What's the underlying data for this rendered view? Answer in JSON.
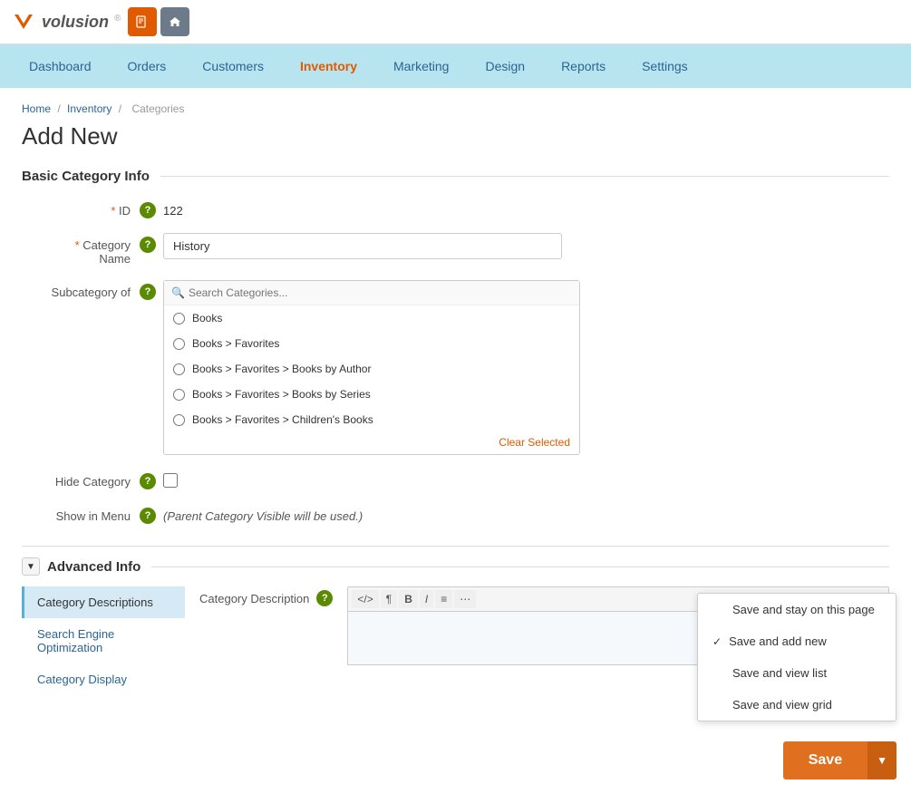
{
  "logo": {
    "text": "volusion"
  },
  "nav": {
    "items": [
      {
        "label": "Dashboard",
        "active": false
      },
      {
        "label": "Orders",
        "active": false
      },
      {
        "label": "Customers",
        "active": false
      },
      {
        "label": "Inventory",
        "active": true
      },
      {
        "label": "Marketing",
        "active": false
      },
      {
        "label": "Design",
        "active": false
      },
      {
        "label": "Reports",
        "active": false
      },
      {
        "label": "Settings",
        "active": false
      }
    ]
  },
  "breadcrumb": {
    "home": "Home",
    "sep1": "/",
    "inventory": "Inventory",
    "sep2": "/",
    "categories": "Categories"
  },
  "page": {
    "title": "Add New"
  },
  "basic_info": {
    "section_title": "Basic Category Info",
    "id_label": "ID",
    "id_value": "122",
    "category_name_label": "Category Name",
    "category_name_value": "History",
    "subcategory_label": "Subcategory of",
    "search_placeholder": "Search Categories...",
    "categories": [
      {
        "label": "Books"
      },
      {
        "label": "Books > Favorites"
      },
      {
        "label": "Books > Favorites > Books by Author"
      },
      {
        "label": "Books > Favorites > Books by Series"
      },
      {
        "label": "Books > Favorites > Children's Books"
      }
    ],
    "clear_selected": "Clear Selected",
    "hide_category_label": "Hide Category",
    "show_in_menu_label": "Show in Menu",
    "show_in_menu_info": "(Parent Category Visible will be used.)"
  },
  "advanced_info": {
    "section_title": "Advanced Info",
    "tabs": [
      {
        "label": "Category Descriptions",
        "active": true
      },
      {
        "label": "Search Engine Optimization",
        "active": false
      },
      {
        "label": "Category Display",
        "active": false
      }
    ],
    "category_description_label": "Category Description",
    "editor_buttons": [
      "</>",
      "¶",
      "B",
      "I",
      "≡",
      "⋯"
    ]
  },
  "save_dropdown": {
    "items": [
      {
        "label": "Save and stay on this page",
        "checked": false
      },
      {
        "label": "Save and add new",
        "checked": true
      },
      {
        "label": "Save and view list",
        "checked": false
      },
      {
        "label": "Save and view grid",
        "checked": false
      }
    ],
    "save_label": "Save"
  }
}
